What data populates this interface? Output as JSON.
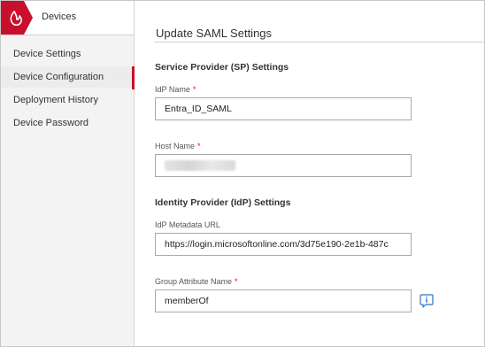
{
  "sidebar": {
    "brand": "Devices",
    "items": [
      {
        "label": "Device Settings"
      },
      {
        "label": "Device Configuration",
        "active": true
      },
      {
        "label": "Deployment History"
      },
      {
        "label": "Device Password"
      }
    ]
  },
  "main": {
    "title": "Update SAML Settings",
    "sp_section": "Service Provider (SP) Settings",
    "idp_name_label": "IdP Name",
    "idp_name_value": "Entra_ID_SAML",
    "host_name_label": "Host Name",
    "idp_section": "Identity Provider (IdP) Settings",
    "metadata_url_label": "IdP Metadata URL",
    "metadata_url_value": "https://login.microsoftonline.com/3d75e190-2e1b-487c",
    "group_attr_label": "Group Attribute Name",
    "group_attr_value": "memberOf",
    "required_marker": "*"
  },
  "colors": {
    "accent": "#c8102e",
    "sidebar_bg": "#f3f3f3",
    "border": "#a9a9a9"
  },
  "icons": {
    "brand": "flame-logo-icon",
    "group_attr_info": "info-icon"
  }
}
